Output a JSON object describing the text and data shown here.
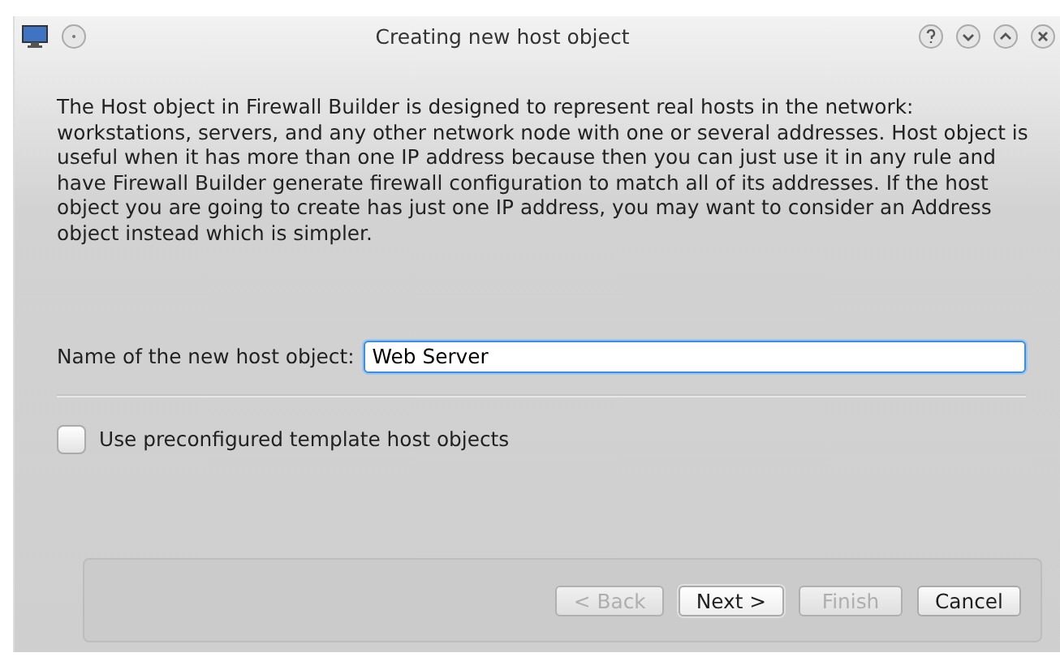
{
  "window": {
    "title": "Creating new host object"
  },
  "description": "The Host object in Firewall Builder is designed to represent real hosts in the network: workstations, servers, and any other network node with one or several addresses. Host object is useful when it has more than one IP address because then you can just use it in any rule and have Firewall Builder generate firewall configuration to match all of its addresses. If the host object you are going to create has just one IP address, you may want to consider an Address object instead which is simpler.",
  "name_field": {
    "label": "Name of the new host object:",
    "value": "Web Server",
    "focused": true
  },
  "template_checkbox": {
    "label": "Use preconfigured template host objects",
    "checked": false
  },
  "buttons": [
    {
      "label": "< Back",
      "disabled": true,
      "default": false
    },
    {
      "label": "Next >",
      "disabled": false,
      "default": true
    },
    {
      "label": "Finish",
      "disabled": true,
      "default": false
    },
    {
      "label": "Cancel",
      "disabled": false,
      "default": false
    }
  ]
}
